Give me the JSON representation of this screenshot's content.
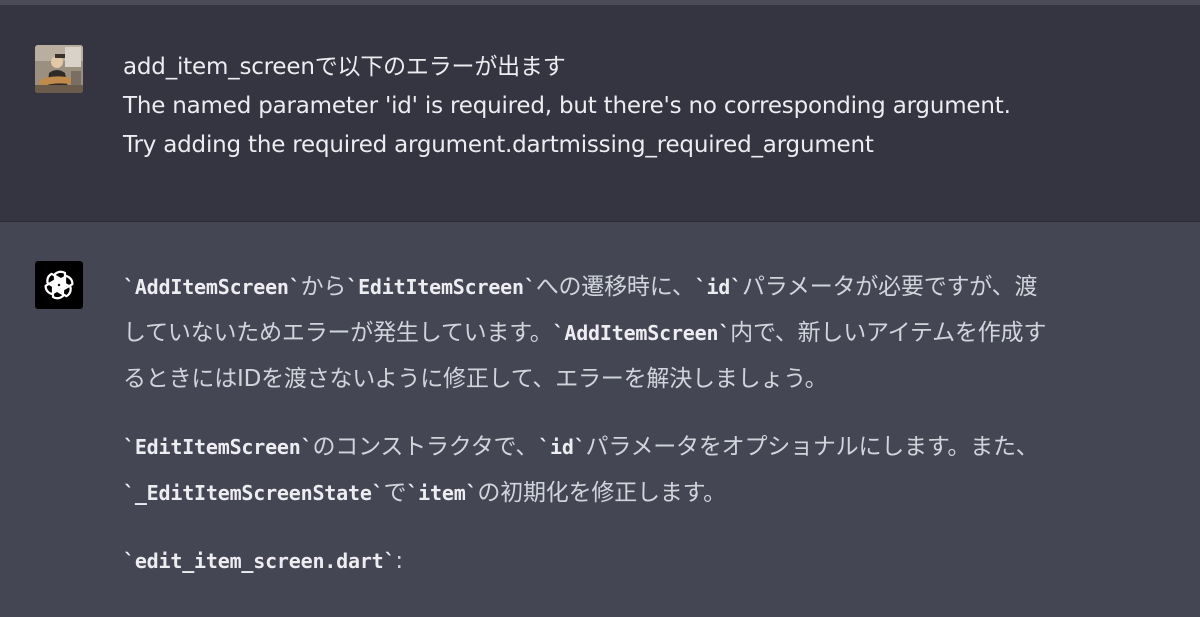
{
  "user_message": {
    "lines": [
      "add_item_screenで以下のエラーが出ます",
      "The named parameter 'id' is required, but there's no corresponding argument.",
      "Try adding the required argument.dartmissing_required_argument"
    ]
  },
  "assistant_message": {
    "p1": {
      "code1": "AddItemScreen",
      "t1": "から",
      "code2": "EditItemScreen",
      "t2": "への遷移時に、",
      "code3": "id",
      "t3": "パラメータが必要ですが、渡",
      "t4": "していないためエラーが発生しています。",
      "code4": "AddItemScreen",
      "t5": "内で、新しいアイテムを作成す",
      "t6": "るときにはIDを渡さないように修正して、エラーを解決しましょう。"
    },
    "p2": {
      "code1": "EditItemScreen",
      "t1": "のコンストラクタで、",
      "code2": "id",
      "t2": "パラメータをオプショナルにします。また、",
      "code3": "_EditItemScreenState",
      "t3": "で",
      "code4": "item",
      "t4": "の初期化を修正します。"
    },
    "p3": {
      "code1": "edit_item_screen.dart",
      "t1": ":"
    }
  },
  "colors": {
    "user_bg": "#343541",
    "assistant_bg": "#444654",
    "text": "#d1d5db",
    "ai_avatar_bg": "#000000"
  },
  "icons": {
    "user_avatar": "user-photo-avatar",
    "assistant_avatar": "openai-logo-icon"
  }
}
